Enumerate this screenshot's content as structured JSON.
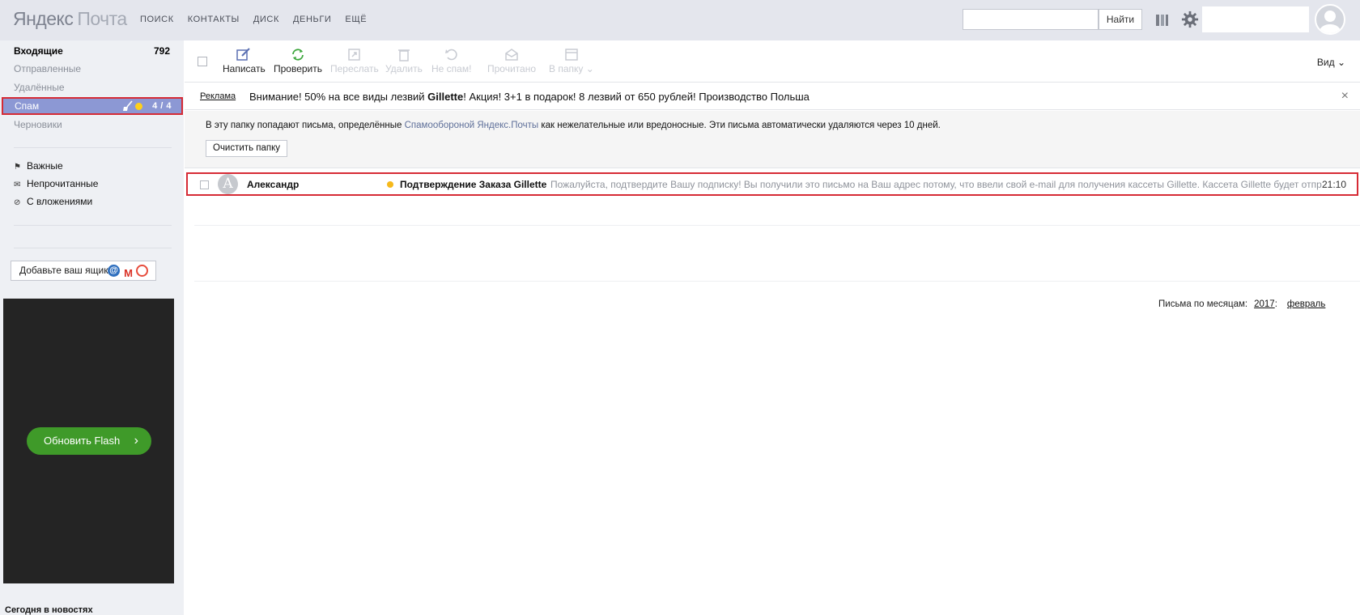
{
  "header": {
    "logo_part1": "Яндекс",
    "logo_part2": "Почта",
    "nav": [
      "ПОИСК",
      "КОНТАКТЫ",
      "ДИСК",
      "ДЕНЬГИ",
      "ЕЩЁ"
    ],
    "search_placeholder": "",
    "search_button": "Найти"
  },
  "sidebar": {
    "folders": [
      {
        "label": "Входящие",
        "count": "792"
      },
      {
        "label": "Отправленные"
      },
      {
        "label": "Удалённые"
      },
      {
        "label": "Спам",
        "count": "4 / 4"
      },
      {
        "label": "Черновики"
      }
    ],
    "labels": [
      {
        "label": "Важные",
        "icon": "flag-icon"
      },
      {
        "label": "Непрочитанные",
        "icon": "envelope-icon"
      },
      {
        "label": "С вложениями",
        "icon": "paperclip-icon"
      }
    ],
    "add_box": "Добавьте ваш ящик",
    "ad_button": "Обновить Flash",
    "news_heading": "Сегодня в новостях"
  },
  "toolbar": {
    "write": "Написать",
    "check": "Проверить",
    "forward": "Переслать",
    "delete": "Удалить",
    "not_spam": "Не спам!",
    "read": "Прочитано",
    "to_folder": "В папку",
    "view": "Вид"
  },
  "adline": {
    "tag": "Реклама",
    "text_before": "Внимание! 50% на все виды лезвий ",
    "brand": "Gillette",
    "text_after": "! Акция! 3+1 в подарок! 8 лезвий от 650 рублей! Производство Польша"
  },
  "notice": {
    "text_before": "В эту папку попадают письма, определённые ",
    "link": "Спамообороной Яндекс.Почты",
    "text_after": " как нежелательные или вредоносные. Эти письма автоматически удаляются через 10 дней.",
    "clear_button": "Очистить папку"
  },
  "messages": [
    {
      "avatar_letter": "А",
      "sender": "Александр",
      "subject": "Подтверждение Заказа Gillette",
      "preview": "Пожалуйста, подтвердите Вашу подписку! Вы получили это письмо на Ваш адрес потому, что ввели свой e-mail для получения кассеты Gillette. Кассета Gillette будет отпр...",
      "time": "21:10"
    }
  ],
  "months": {
    "label": "Письма по месяцам:",
    "year": "2017",
    "month": "февраль"
  },
  "colors": {
    "spam_highlight": "#8c98d4",
    "annotation_border": "#d62b35",
    "flash_button": "#3f9a29",
    "unread_dot": "#f6b91b"
  }
}
